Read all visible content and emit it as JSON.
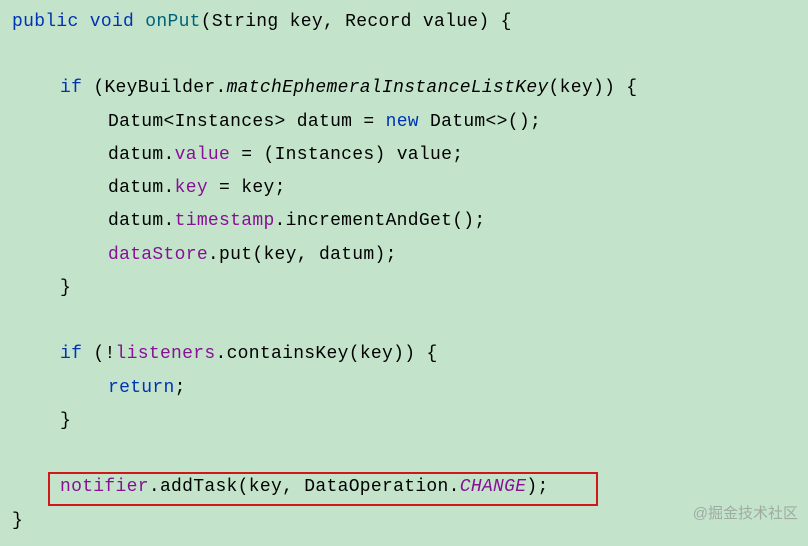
{
  "code": {
    "kw_public": "public",
    "kw_void": "void",
    "method_onPut": "onPut",
    "type_String": "String",
    "param_key": "key",
    "type_Record": "Record",
    "param_value": "value",
    "kw_if": "if",
    "type_KeyBuilder": "KeyBuilder",
    "method_matchEphemeral": "matchEphemeralInstanceListKey",
    "arg_key": "key",
    "type_Datum": "Datum",
    "type_Instances": "Instances",
    "var_datum": "datum",
    "kw_new": "new",
    "field_value": "value",
    "cast_Instances": "Instances",
    "var_value": "value",
    "field_key": "key",
    "var_key": "key",
    "field_timestamp": "timestamp",
    "method_incrementAndGet": "incrementAndGet",
    "field_dataStore": "dataStore",
    "method_put": "put",
    "field_listeners": "listeners",
    "method_containsKey": "containsKey",
    "kw_return": "return",
    "field_notifier": "notifier",
    "method_addTask": "addTask",
    "type_DataOperation": "DataOperation",
    "const_CHANGE": "CHANGE"
  },
  "punct": {
    "open_paren": "(",
    "close_paren": ")",
    "open_brace": "{",
    "close_brace": "}",
    "open_angle": "<",
    "close_angle": ">",
    "diamond": "<>",
    "comma_sp": ", ",
    "space": " ",
    "semi": ";",
    "dot": ".",
    "assign": " = ",
    "not": "!"
  },
  "watermark": "@掘金技术社区"
}
